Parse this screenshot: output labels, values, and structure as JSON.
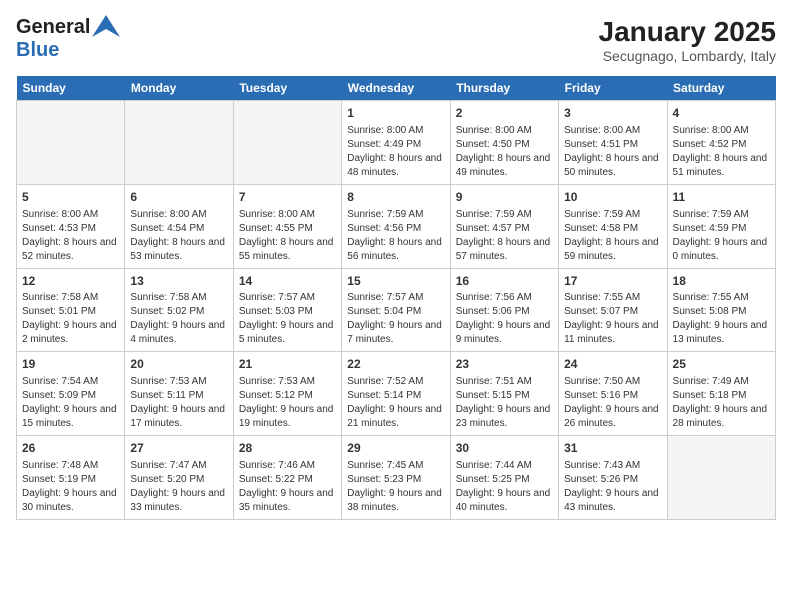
{
  "logo": {
    "line1": "General",
    "line2": "Blue"
  },
  "title": {
    "month": "January 2025",
    "location": "Secugnago, Lombardy, Italy"
  },
  "days_of_week": [
    "Sunday",
    "Monday",
    "Tuesday",
    "Wednesday",
    "Thursday",
    "Friday",
    "Saturday"
  ],
  "weeks": [
    [
      {
        "day": "",
        "empty": true
      },
      {
        "day": "",
        "empty": true
      },
      {
        "day": "",
        "empty": true
      },
      {
        "day": "1",
        "sunrise": "8:00 AM",
        "sunset": "4:49 PM",
        "daylight": "8 hours and 48 minutes."
      },
      {
        "day": "2",
        "sunrise": "8:00 AM",
        "sunset": "4:50 PM",
        "daylight": "8 hours and 49 minutes."
      },
      {
        "day": "3",
        "sunrise": "8:00 AM",
        "sunset": "4:51 PM",
        "daylight": "8 hours and 50 minutes."
      },
      {
        "day": "4",
        "sunrise": "8:00 AM",
        "sunset": "4:52 PM",
        "daylight": "8 hours and 51 minutes."
      }
    ],
    [
      {
        "day": "5",
        "sunrise": "8:00 AM",
        "sunset": "4:53 PM",
        "daylight": "8 hours and 52 minutes."
      },
      {
        "day": "6",
        "sunrise": "8:00 AM",
        "sunset": "4:54 PM",
        "daylight": "8 hours and 53 minutes."
      },
      {
        "day": "7",
        "sunrise": "8:00 AM",
        "sunset": "4:55 PM",
        "daylight": "8 hours and 55 minutes."
      },
      {
        "day": "8",
        "sunrise": "7:59 AM",
        "sunset": "4:56 PM",
        "daylight": "8 hours and 56 minutes."
      },
      {
        "day": "9",
        "sunrise": "7:59 AM",
        "sunset": "4:57 PM",
        "daylight": "8 hours and 57 minutes."
      },
      {
        "day": "10",
        "sunrise": "7:59 AM",
        "sunset": "4:58 PM",
        "daylight": "8 hours and 59 minutes."
      },
      {
        "day": "11",
        "sunrise": "7:59 AM",
        "sunset": "4:59 PM",
        "daylight": "9 hours and 0 minutes."
      }
    ],
    [
      {
        "day": "12",
        "sunrise": "7:58 AM",
        "sunset": "5:01 PM",
        "daylight": "9 hours and 2 minutes."
      },
      {
        "day": "13",
        "sunrise": "7:58 AM",
        "sunset": "5:02 PM",
        "daylight": "9 hours and 4 minutes."
      },
      {
        "day": "14",
        "sunrise": "7:57 AM",
        "sunset": "5:03 PM",
        "daylight": "9 hours and 5 minutes."
      },
      {
        "day": "15",
        "sunrise": "7:57 AM",
        "sunset": "5:04 PM",
        "daylight": "9 hours and 7 minutes."
      },
      {
        "day": "16",
        "sunrise": "7:56 AM",
        "sunset": "5:06 PM",
        "daylight": "9 hours and 9 minutes."
      },
      {
        "day": "17",
        "sunrise": "7:55 AM",
        "sunset": "5:07 PM",
        "daylight": "9 hours and 11 minutes."
      },
      {
        "day": "18",
        "sunrise": "7:55 AM",
        "sunset": "5:08 PM",
        "daylight": "9 hours and 13 minutes."
      }
    ],
    [
      {
        "day": "19",
        "sunrise": "7:54 AM",
        "sunset": "5:09 PM",
        "daylight": "9 hours and 15 minutes."
      },
      {
        "day": "20",
        "sunrise": "7:53 AM",
        "sunset": "5:11 PM",
        "daylight": "9 hours and 17 minutes."
      },
      {
        "day": "21",
        "sunrise": "7:53 AM",
        "sunset": "5:12 PM",
        "daylight": "9 hours and 19 minutes."
      },
      {
        "day": "22",
        "sunrise": "7:52 AM",
        "sunset": "5:14 PM",
        "daylight": "9 hours and 21 minutes."
      },
      {
        "day": "23",
        "sunrise": "7:51 AM",
        "sunset": "5:15 PM",
        "daylight": "9 hours and 23 minutes."
      },
      {
        "day": "24",
        "sunrise": "7:50 AM",
        "sunset": "5:16 PM",
        "daylight": "9 hours and 26 minutes."
      },
      {
        "day": "25",
        "sunrise": "7:49 AM",
        "sunset": "5:18 PM",
        "daylight": "9 hours and 28 minutes."
      }
    ],
    [
      {
        "day": "26",
        "sunrise": "7:48 AM",
        "sunset": "5:19 PM",
        "daylight": "9 hours and 30 minutes."
      },
      {
        "day": "27",
        "sunrise": "7:47 AM",
        "sunset": "5:20 PM",
        "daylight": "9 hours and 33 minutes."
      },
      {
        "day": "28",
        "sunrise": "7:46 AM",
        "sunset": "5:22 PM",
        "daylight": "9 hours and 35 minutes."
      },
      {
        "day": "29",
        "sunrise": "7:45 AM",
        "sunset": "5:23 PM",
        "daylight": "9 hours and 38 minutes."
      },
      {
        "day": "30",
        "sunrise": "7:44 AM",
        "sunset": "5:25 PM",
        "daylight": "9 hours and 40 minutes."
      },
      {
        "day": "31",
        "sunrise": "7:43 AM",
        "sunset": "5:26 PM",
        "daylight": "9 hours and 43 minutes."
      },
      {
        "day": "",
        "empty": true
      }
    ]
  ]
}
